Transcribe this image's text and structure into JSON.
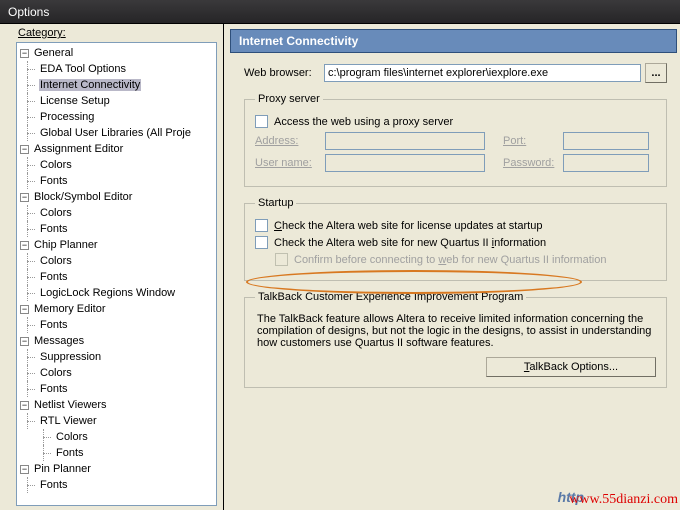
{
  "window": {
    "title": "Options"
  },
  "left": {
    "category_label": "Category:",
    "tree": {
      "general": "General",
      "eda": "EDA Tool Options",
      "internet": "Internet Connectivity",
      "license": "License Setup",
      "processing": "Processing",
      "global": "Global User Libraries (All Proje",
      "asg": "Assignment Editor",
      "colors": "Colors",
      "fonts": "Fonts",
      "block": "Block/Symbol Editor",
      "chip": "Chip Planner",
      "logic": "LogicLock Regions Window",
      "mem": "Memory Editor",
      "msg": "Messages",
      "suppression": "Suppression",
      "netlist": "Netlist Viewers",
      "rtl": "RTL Viewer",
      "pin": "Pin Planner"
    }
  },
  "right": {
    "header": "Internet Connectivity",
    "web_browser_label": "Web browser:",
    "web_browser_value": "c:\\program files\\internet explorer\\iexplore.exe",
    "browse": "...",
    "proxy": {
      "legend": "Proxy server",
      "access": "Access the web using a proxy server",
      "address": "Address:",
      "port": "Port:",
      "user": "User name:",
      "password": "Password:"
    },
    "startup": {
      "legend": "Startup",
      "license": "Check the Altera web site for license updates at startup",
      "info": "Check the Altera web site for new Quartus II information",
      "confirm": "Confirm before connecting to web for new Quartus II information"
    },
    "talkback": {
      "legend": "TalkBack Customer Experience Improvement Program",
      "body": "The TalkBack feature allows Altera to receive limited information concerning the compilation of designs, but not the logic in the designs, to assist in understanding how customers use Quartus II software features.",
      "button": "TalkBack Options..."
    }
  },
  "footer": {
    "http": "http",
    "wm": "www.55dianzi.com"
  }
}
